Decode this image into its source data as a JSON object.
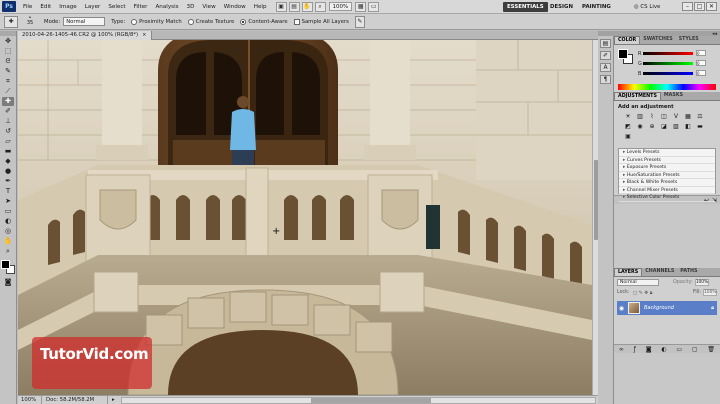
{
  "app": {
    "logo": "Ps",
    "menu": [
      "File",
      "Edit",
      "Image",
      "Layer",
      "Select",
      "Filter",
      "Analysis",
      "3D",
      "View",
      "Window",
      "Help"
    ],
    "zoom": "100%",
    "workspaces": {
      "essentials": "ESSENTIALS",
      "design": "DESIGN",
      "painting": "PAINTING",
      "cslive": "CS Live"
    },
    "window_buttons": [
      "–",
      "□",
      "✕"
    ]
  },
  "options": {
    "brush_size": "35",
    "mode_label": "Mode:",
    "mode_value": "Normal",
    "type_label": "Type:",
    "type_options": [
      "Proximity Match",
      "Create Texture",
      "Content-Aware"
    ],
    "type_selected": "Content-Aware",
    "sample_all_layers": "Sample All Layers"
  },
  "document": {
    "tab_title": "2010-04-26-1405-46.CR2 @ 100% (RGB/8*)",
    "close": "×",
    "status_zoom": "100%",
    "status_doc": "Doc: 58.2M/58.2M",
    "watermark": "TutorVid.com"
  },
  "panels": {
    "color_tabs": [
      "COLOR",
      "SWATCHES",
      "STYLES"
    ],
    "color_values": {
      "r": "0",
      "g": "0",
      "b": "0"
    },
    "adjust_tabs": [
      "ADJUSTMENTS",
      "MASKS"
    ],
    "adjust_title": "Add an adjustment",
    "presets": [
      "Levels Presets",
      "Curves Presets",
      "Exposure Presets",
      "Hue/Saturation Presets",
      "Black & White Presets",
      "Channel Mixer Presets",
      "Selective Color Presets"
    ],
    "layers_tabs": [
      "LAYERS",
      "CHANNELS",
      "PATHS"
    ],
    "layers_blend": "Normal",
    "layers_opacity_label": "Opacity:",
    "layers_opacity": "100%",
    "layers_lock_label": "Lock:",
    "layers_fill_label": "Fill:",
    "layers_fill": "100%",
    "layer_name": "Background"
  },
  "colors": {
    "accent": "#3d3d3d",
    "layer_selected": "#5a7fc8",
    "watermark": "#d22828"
  },
  "icons": [
    "photoshop-logo",
    "eye-icon",
    "lock-icon",
    "close-icon",
    "hand-icon",
    "zoom-icon",
    "heal-brush-icon"
  ]
}
